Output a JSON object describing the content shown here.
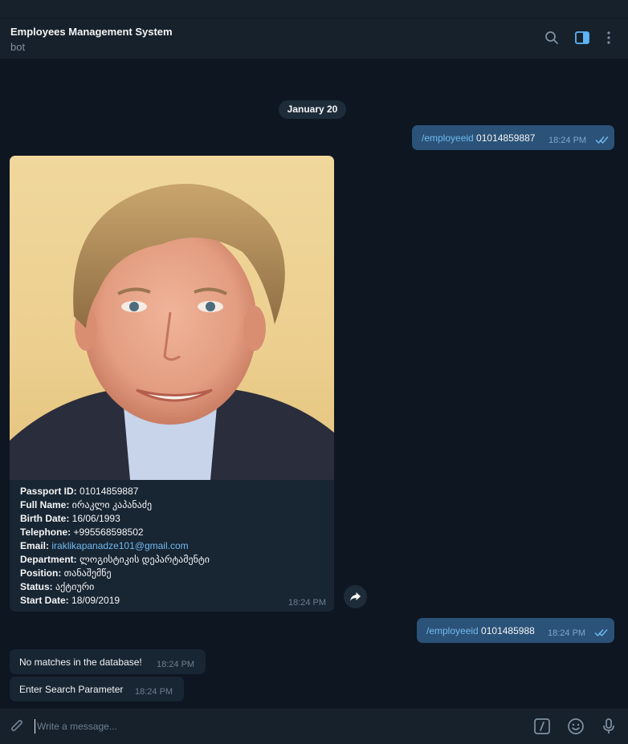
{
  "header": {
    "title": "Employees Management System",
    "subtitle": "bot",
    "icons": [
      "search-icon",
      "sidebar-toggle-icon",
      "more-vertical-icon"
    ]
  },
  "date_separator": "January 20",
  "messages": {
    "out1": {
      "command": "/employeeid",
      "text": " 01014859887",
      "time": "18:24 PM"
    },
    "photo": {
      "fields": {
        "passport_label": "Passport ID:",
        "passport_value": " 01014859887",
        "fullname_label": "Full Name:",
        "fullname_value": " ირაკლი კაპანაძე",
        "birth_label": "Birth Date:",
        "birth_value": " 16/06/1993",
        "phone_label": "Telephone:",
        "phone_value": " +995568598502",
        "email_label": "Email:",
        "email_value": "iraklikapanadze101@gmail.com",
        "dept_label": "Department:",
        "dept_value": " ლოგისტიკის დეპარტამენტი",
        "position_label": "Position:",
        "position_value": " თანაშემწე",
        "status_label": "Status:",
        "status_value": " აქტიური",
        "start_label": "Start Date:",
        "start_value": " 18/09/2019"
      },
      "time": "18:24 PM"
    },
    "out2": {
      "command": "/employeeid",
      "text": " 0101485988",
      "time": "18:24 PM"
    },
    "in1": {
      "text": "No matches in the database!",
      "time": "18:24 PM"
    },
    "in2": {
      "text": "Enter Search Parameter",
      "time": "18:24 PM"
    }
  },
  "composer": {
    "placeholder": "Write a message...",
    "icons": [
      "paperclip-icon",
      "bot-command-icon",
      "emoji-icon",
      "microphone-icon"
    ]
  },
  "colors": {
    "background": "#0e1621",
    "header": "#17212b",
    "outgoing": "#2b5278",
    "incoming": "#182533",
    "link": "#71baf0"
  }
}
